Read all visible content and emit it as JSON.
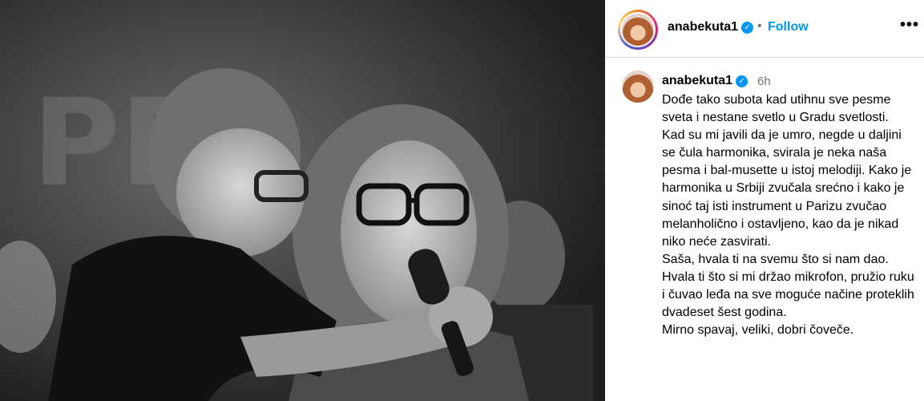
{
  "post": {
    "image_alt_icon": "post-photo"
  },
  "header": {
    "username": "anabekuta1",
    "verified_icon": "verified-badge-icon",
    "separator": "•",
    "follow_label": "Follow",
    "more_icon": "more-options-icon",
    "more_label": "•••"
  },
  "caption": {
    "username": "anabekuta1",
    "time": "6h",
    "lines": [
      "Dođe tako subota kad utihnu sve pesme sveta i nestane svetlo u Gradu svetlosti.",
      "Kad su mi javili da je umro, negde u daljini se čula harmonika, svirala je neka naša pesma i bal-musette u istoj melodiji. Kako je harmonika u Srbiji zvučala srećno i kako je sinoć taj isti instrument u Parizu zvučao melanholično i ostavljeno, kao da je nikad niko neće zasvirati.",
      "Saša, hvala ti na svemu što si nam dao.",
      "Hvala ti što si mi držao mikrofon, pružio ruku i čuvao leđa na sve moguće načine proteklih dvadeset šest godina.",
      "Mirno spavaj, veliki, dobri čoveče."
    ]
  },
  "colors": {
    "accent": "#0095f6",
    "muted": "#737373",
    "divider": "#dbdbdb"
  }
}
